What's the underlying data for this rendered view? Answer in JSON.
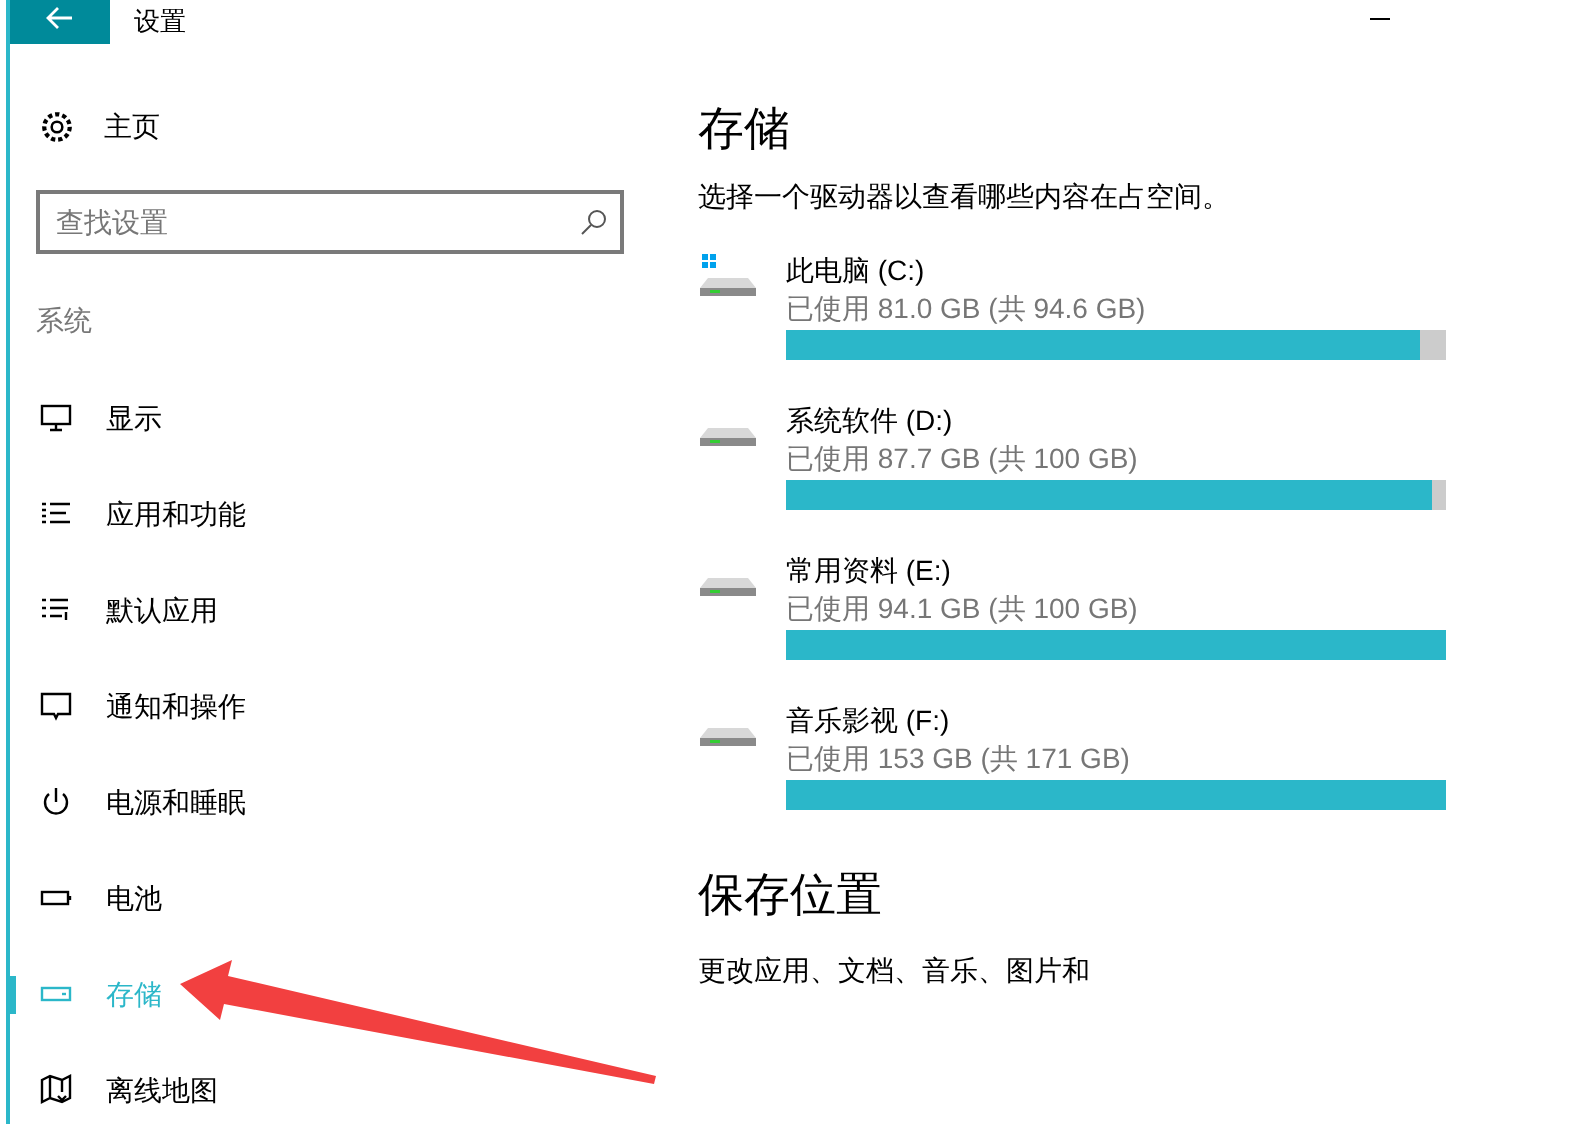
{
  "window": {
    "title": "设置"
  },
  "sidebar": {
    "home": "主页",
    "search": {
      "placeholder": "查找设置"
    },
    "section": "系统",
    "items": [
      {
        "kind": "display",
        "label": "显示",
        "selected": false
      },
      {
        "kind": "apps",
        "label": "应用和功能",
        "selected": false
      },
      {
        "kind": "defaults",
        "label": "默认应用",
        "selected": false
      },
      {
        "kind": "notifications",
        "label": "通知和操作",
        "selected": false
      },
      {
        "kind": "power",
        "label": "电源和睡眠",
        "selected": false
      },
      {
        "kind": "battery",
        "label": "电池",
        "selected": false
      },
      {
        "kind": "storage",
        "label": "存储",
        "selected": true
      },
      {
        "kind": "maps",
        "label": "离线地图",
        "selected": false
      }
    ]
  },
  "main": {
    "title": "存储",
    "description": "选择一个驱动器以查看哪些内容在占空间。",
    "drives": [
      {
        "name": "此电脑 (C:)",
        "usage": "已使用 81.0 GB (共 94.6 GB)",
        "level": 0.96,
        "system": true
      },
      {
        "name": "系统软件 (D:)",
        "usage": "已使用 87.7 GB (共 100 GB)",
        "level": 0.98,
        "system": false
      },
      {
        "name": "常用资料 (E:)",
        "usage": "已使用 94.1 GB (共 100 GB)",
        "level": 1,
        "system": false
      },
      {
        "name": "音乐影视 (F:)",
        "usage": "已使用 153 GB (共 171 GB)",
        "level": 1,
        "system": false
      }
    ],
    "save_title": "保存位置",
    "save_description": "更改应用、文档、音乐、图片和"
  }
}
